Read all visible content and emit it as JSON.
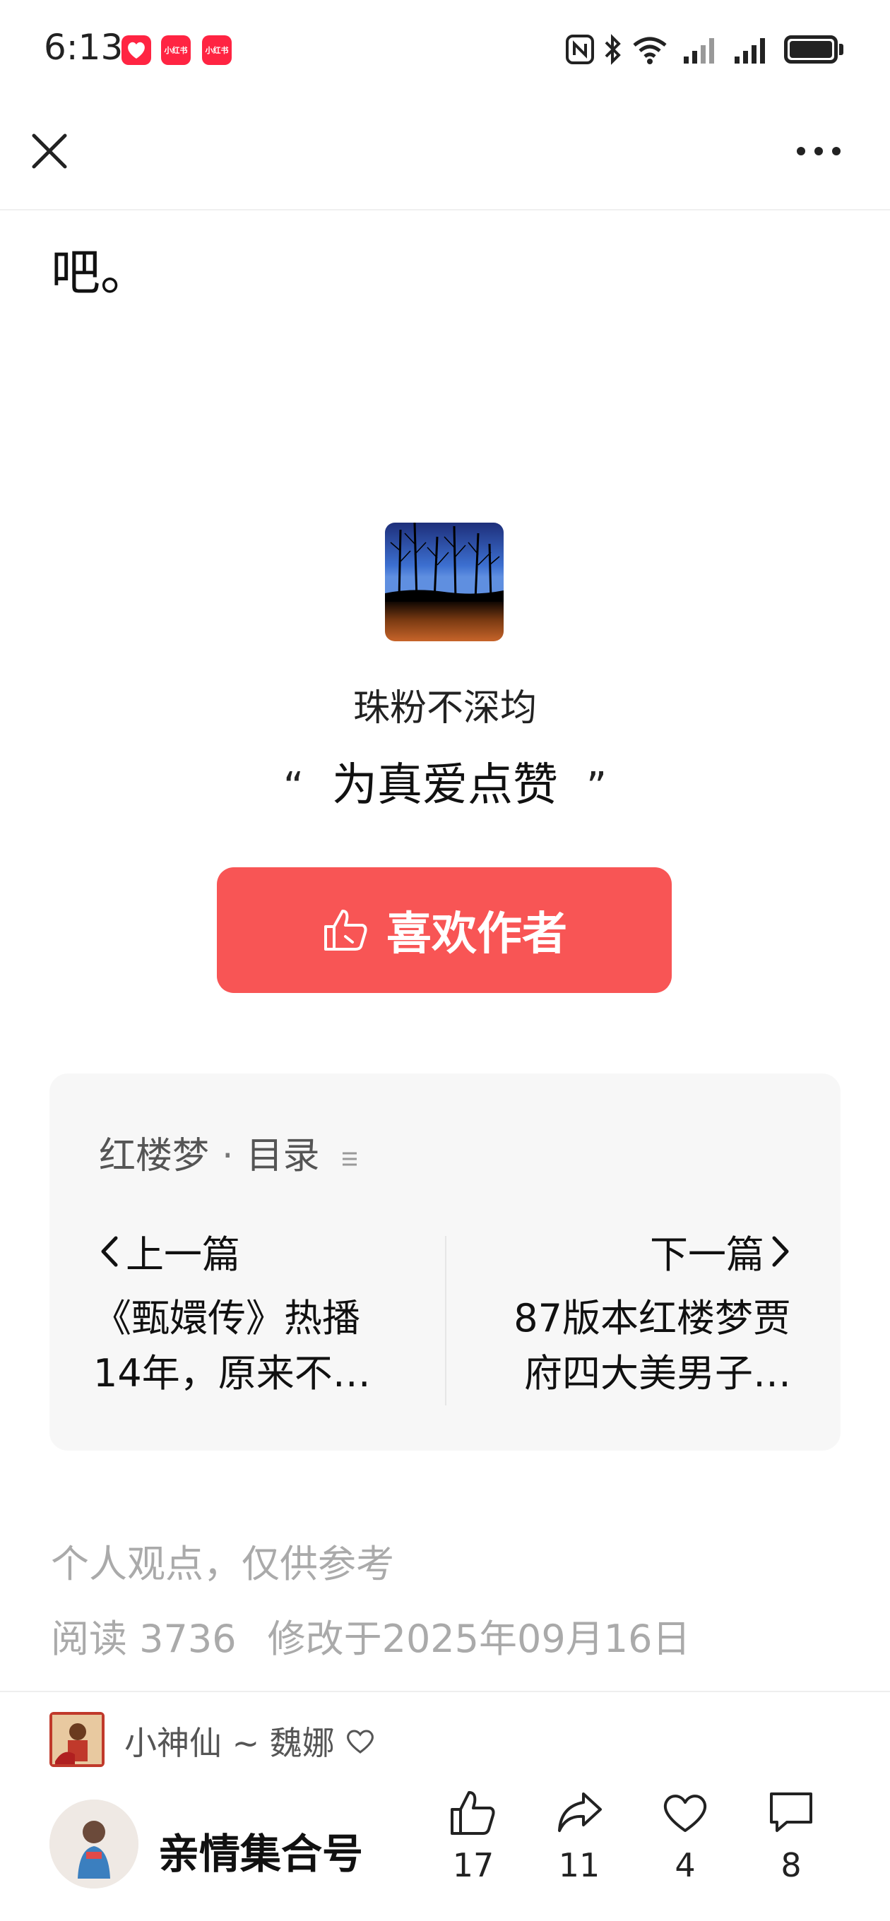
{
  "status_bar": {
    "time": "6:13",
    "app_badges": [
      "小红书",
      "小红书"
    ],
    "icons": [
      "nfc-icon",
      "bluetooth-icon",
      "wifi-icon",
      "signal-icon",
      "signal-icon",
      "battery-icon"
    ]
  },
  "topbar": {
    "close_icon": "close-icon",
    "more_icon": "more-icon"
  },
  "article": {
    "body_tail": "吧。",
    "author_name": "珠粉不深均",
    "quote_open": "“",
    "quote": "为真爱点赞",
    "quote_close": "”",
    "like_author_label": "喜欢作者"
  },
  "catalog": {
    "collection": "红楼梦",
    "separator": "·",
    "toc_label": "目录",
    "prev_label": "上一篇",
    "prev_title": "《甄嬛传》热播14年，原来不…",
    "next_label": "下一篇",
    "next_title": "87版本红楼梦贾府四大美男子…"
  },
  "footer_info": {
    "disclaimer": "个人观点，仅供参考",
    "reads": "阅读 3736",
    "modified": "修改于2025年09月16日"
  },
  "bottom_bar": {
    "commenter": "小神仙 ~ 魏娜",
    "account_name": "亲情集合号",
    "actions": [
      {
        "icon": "thumbs-up-icon",
        "count": "17"
      },
      {
        "icon": "share-icon",
        "count": "11"
      },
      {
        "icon": "heart-icon",
        "count": "4"
      },
      {
        "icon": "comment-icon",
        "count": "8"
      }
    ]
  },
  "colors": {
    "accent": "#f85555",
    "card_bg": "#f7f7f7",
    "muted_text": "#aaaaaa"
  }
}
